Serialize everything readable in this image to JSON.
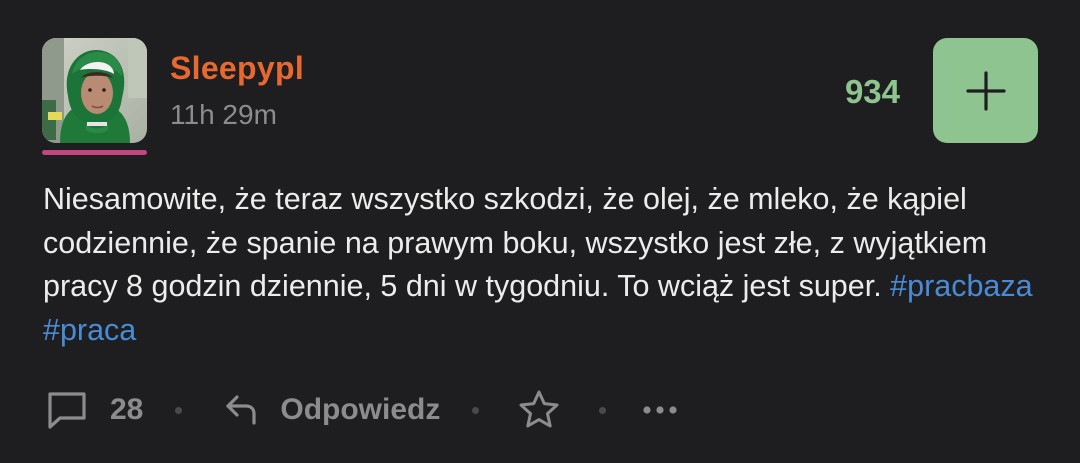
{
  "post": {
    "author": "Sleepypl",
    "time_ago": "11h 29m",
    "votes": "934",
    "body_text": "Niesamowite, że teraz wszystko szkodzi, że olej, że mleko, że kąpiel codziennie, że spanie na prawym boku, wszystko jest złe, z wyjątkiem pracy 8 godzin dziennie, 5 dni w tygodniu. To wciąż jest super.",
    "hashtags": [
      "#pracbaza",
      "#praca"
    ]
  },
  "actions": {
    "comments_count": "28",
    "reply_label": "Odpowiedz"
  },
  "icons": {
    "plus": "plus-icon",
    "comment": "comment-icon",
    "reply": "reply-icon",
    "favorite": "star-icon",
    "more": "more-icon"
  },
  "colors": {
    "background": "#1e1e20",
    "author": "#e8692f",
    "votes_accent": "#8ec48f",
    "hashtag": "#4a8bd6",
    "avatar_underline": "#c2467e"
  }
}
